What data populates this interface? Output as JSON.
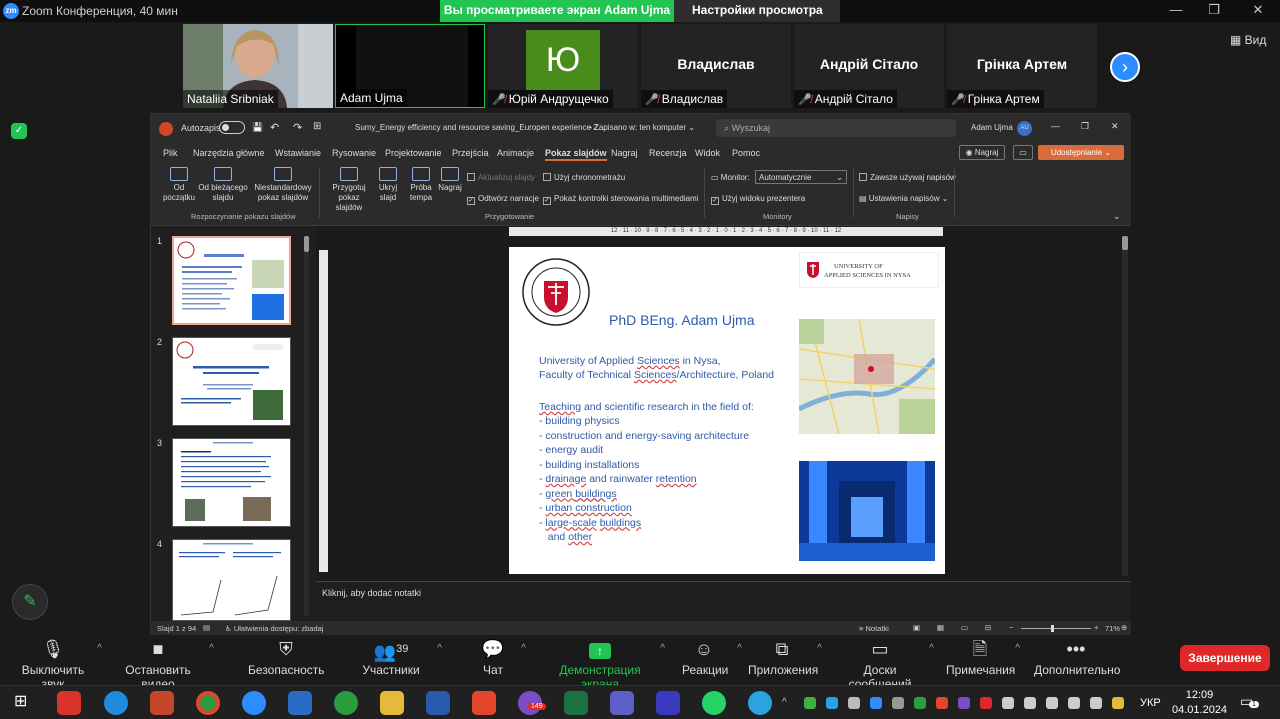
{
  "zoom": {
    "title": "Zoom Конференция, 40 мин",
    "share_banner": "Вы просматриваете экран Adam Ujma",
    "view_settings": "Настройки просмотра",
    "view_label": "Вид",
    "participants": [
      {
        "name": "Nataliia Sribniak",
        "muted": false
      },
      {
        "name": "Adam Ujma",
        "muted": false
      },
      {
        "name": "Юрій Андрущечко",
        "muted": true,
        "initial": "Ю"
      },
      {
        "name": "Владислав",
        "muted": true,
        "big": "Владислав"
      },
      {
        "name": "Андрій Сітало",
        "muted": true,
        "big": "Андрій Сітало"
      },
      {
        "name": "Грінка Артем",
        "muted": true,
        "big": "Грінка Артем"
      }
    ],
    "toolbar": {
      "mute": "Выключить звук",
      "video": "Остановить видео",
      "security": "Безопасность",
      "participants": "Участники",
      "participants_count": "39",
      "chat": "Чат",
      "share": "Демонстрация экрана",
      "reactions": "Реакции",
      "apps": "Приложения",
      "whiteboards": "Доски сообщений",
      "notes": "Примечания",
      "more": "Дополнительно",
      "end": "Завершение"
    }
  },
  "ppt": {
    "autosave": "Autozapis",
    "filename": "Sumy_Energy efficiency and resource saving_Europen experience 2...",
    "saved": "• Zapisano w: ten komputer",
    "search_placeholder": "Wyszukaj",
    "user": "Adam Ujma",
    "user_initials": "AU",
    "record_btn": "Nagraj",
    "share_btn": "Udostępnianie",
    "menu": [
      "Plik",
      "Narzędzia główne",
      "Wstawianie",
      "Rysowanie",
      "Projektowanie",
      "Przejścia",
      "Animacje",
      "Pokaz slajdów",
      "Nagraj",
      "Recenzja",
      "Widok",
      "Pomoc"
    ],
    "active_menu": "Pokaz slajdów",
    "ribbon": {
      "from_start": "Od początku",
      "from_current": "Od bieżącego slajdu",
      "custom": "Niestandardowy pokaz slajdów",
      "group1": "Rozpoczynanie pokazu slajdów",
      "setup": "Przygotuj pokaz slajdów",
      "hide": "Ukryj slajd",
      "rehearse": "Próba tempa",
      "record": "Nagraj",
      "update": "Aktualizuj slajdy",
      "play_narration": "Odtwórz narracje",
      "use_timings": "Użyj chronometrażu",
      "show_media": "Pokaż kontrolki sterowania multimediami",
      "group2": "Przygotowanie",
      "monitor_label": "Monitor:",
      "monitor_value": "Automatycznie",
      "presenter_view": "Użyj widoku prezentera",
      "group3": "Monitory",
      "always_captions": "Zawsze używaj napisów",
      "caption_settings": "Ustawienia napisów",
      "group4": "Napisy"
    },
    "ruler": "12 · 11 · 10 · 9 · 8 · 7 · 6 · 5 · 4 · 3 · 2 · 1 · 0 · 1 · 2 · 3 · 4 · 5 · 6 · 7 · 8 · 9 · 10 · 11 · 12",
    "slide_numbers": [
      "1",
      "2",
      "3",
      "4"
    ],
    "notes_placeholder": "Kliknij, aby dodać notatki",
    "status": {
      "slide": "Slajd 1 z 94",
      "accessibility": "Ułatwienia dostępu: zbadaj",
      "notes": "Notatki",
      "zoom": "71%"
    },
    "slide": {
      "title": "PhD BEng. Adam Ujma",
      "uni_bold": "University of Applied Sciences in Nysa,",
      "faculty": "Faculty of Technical Sciences/Architecture,  Poland",
      "teaching": "Teaching and scientific research in the field of:",
      "items": [
        "-  building physics",
        "-  construction and energy-saving architecture",
        "-  energy audit",
        "-  building installations",
        "-  drainage and rainwater retention",
        "-  green buildings",
        "-  urban construction",
        "-  large-scale buildings",
        "   and other"
      ],
      "logo_line1": "UNIVERSITY OF",
      "logo_line2": "APPLIED SCIENCES IN NYSA"
    }
  },
  "taskbar": {
    "lang": "УКР",
    "time": "12:09",
    "date": "04.01.2024",
    "viber_badge": "149",
    "notif_badge": "1"
  }
}
